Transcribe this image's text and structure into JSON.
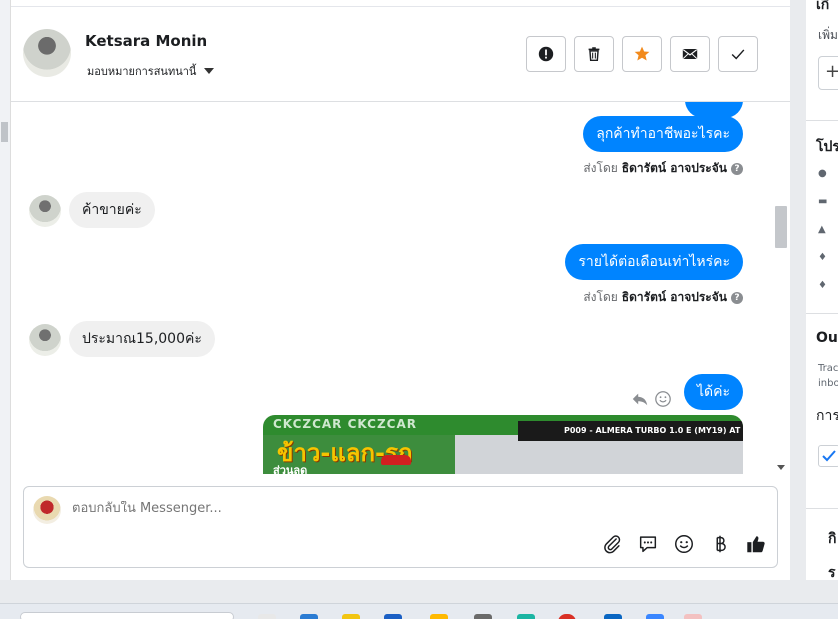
{
  "header": {
    "name": "Ketsara Monin",
    "assign_label": "มอบหมายการสนทนานี้"
  },
  "actions": {
    "spam": "spam-icon",
    "delete": "trash-icon",
    "star": "star-icon",
    "unread": "envelope-icon",
    "done": "check-icon",
    "star_color": "#f28a1c"
  },
  "messages": [
    {
      "direction": "out",
      "text": "ลุกค้าทำอาชีพอะไรคะ",
      "sent_by_prefix": "ส่งโดย",
      "sent_by_name": "ธิดารัตน์ อาจประจัน"
    },
    {
      "direction": "in",
      "text": "ค้าขายค่ะ"
    },
    {
      "direction": "out",
      "text": "รายได้ต่อเดือนเท่าไหร่คะ",
      "sent_by_prefix": "ส่งโดย",
      "sent_by_name": "ธิดารัตน์ อาจประจัน"
    },
    {
      "direction": "in",
      "text": "ประมาณ15,000ค่ะ"
    },
    {
      "direction": "out",
      "text": "ได้ค่ะ"
    }
  ],
  "promo_image": {
    "top_text": "CKCZCAR CKCZCAR",
    "banner_text": "P009 - ALMERA TURBO 1.0 E (MY19) AT",
    "headline": "ข้าว-แลก-รถ",
    "sub": "ส่วนลด"
  },
  "composer": {
    "placeholder": "ตอบกลับใน Messenger...",
    "tools": [
      "attach-icon",
      "quick-reply-icon",
      "emoji-icon",
      "currency-icon",
      "like-icon"
    ]
  },
  "right_panel": {
    "title_1": "เกี",
    "sub_1": "เพิ่ม",
    "title_2": "โปร",
    "title_3": "Ou",
    "small_3a": "Trac",
    "small_3b": "inbo",
    "title_4": "การ",
    "title_5": "กิ",
    "title_6": "ร"
  },
  "colors": {
    "outgoing": "#0084ff",
    "incoming": "#f0f0f0"
  }
}
